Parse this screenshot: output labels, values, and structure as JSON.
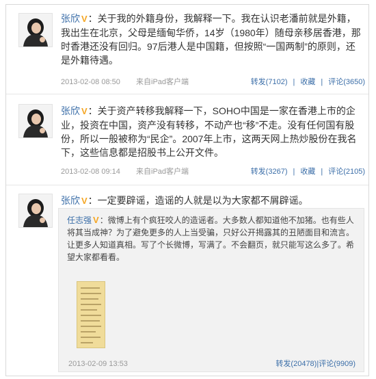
{
  "posts": [
    {
      "author": "张欣",
      "vip_mark": "V",
      "text": "：关于我的外籍身份，我解释一下。我在认识老潘前就是外籍，我出生在北京，父母是缅甸华侨，14岁（1980年）随母亲移居香港，那时香港还没有回归。97后港人是中国籍，但按照“一国两制”的原则，还是外籍待遇。",
      "time": "2013-02-08 08:50",
      "source": "来自iPad客户端",
      "repost": "转发(7102)",
      "fav": "收藏",
      "comment": "评论(3650)"
    },
    {
      "author": "张欣",
      "vip_mark": "V",
      "text": "：关于资产转移我解释一下，SOHO中国是一家在香港上市的企业，投资在中国，资产没有转移，不动产也“移”不走。没有任何国有股份，所以一般被称为“民企”。2007年上市，这两天网上热炒股份在我名下，这些信息都是招股书上公开文件。",
      "time": "2013-02-08 09:14",
      "source": "来自iPad客户端",
      "repost": "转发(3267)",
      "fav": "收藏",
      "comment": "评论(2105)"
    },
    {
      "author": "张欣",
      "vip_mark": "V",
      "text": "：一定要辟谣，造谣的人就是以为大家都不屑辟谣。",
      "quoted": {
        "author": "任志强",
        "vip_mark": "V",
        "text": "：微博上有个疯狂咬人的造谣者。大多数人都知道他不加猪。也有些人将其当成神？为了避免更多的人上当受骗，只好公开揭露其的丑陋面目和流言。让更多人知道真相。写了个长微博，写满了。不会翻页，就只能写这么多了。希望大家都看看。",
        "time": "2013-02-09 13:53",
        "repost": "转发(20478)",
        "comment": "评论(9909)"
      }
    }
  ],
  "colors": {
    "link": "#3b6ea8",
    "vip": "#f5a623",
    "meta": "#999999"
  }
}
